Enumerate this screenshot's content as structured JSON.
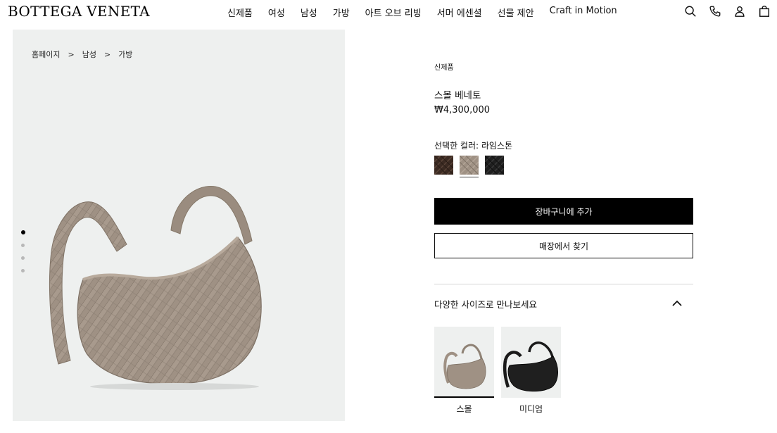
{
  "header": {
    "logo": "BOTTEGA VENETA",
    "nav": [
      "신제품",
      "여성",
      "남성",
      "가방",
      "아트 오브 리빙",
      "서머 에센셜",
      "선물 제안",
      "Craft in Motion"
    ],
    "icons": [
      "search-icon",
      "phone-icon",
      "account-icon",
      "shopping-bag-icon"
    ]
  },
  "breadcrumb": [
    "홈페이지",
    "남성",
    "가방"
  ],
  "gallery": {
    "dots": 4,
    "active_dot": 1
  },
  "product": {
    "badge": "신제품",
    "name": "스몰 베네토",
    "price": "₩4,300,000",
    "color_label": "선택한 컬러: 라임스톤",
    "colors": [
      {
        "name": "dark-brown",
        "hex": "#3b2a22"
      },
      {
        "name": "limestone",
        "hex": "#9f9184",
        "selected": true
      },
      {
        "name": "black",
        "hex": "#1f1f1f"
      }
    ],
    "add_to_cart": "장바구니에 추가",
    "find_in_store": "매장에서 찾기"
  },
  "sizes": {
    "title": "다양한 사이즈로 만나보세요",
    "items": [
      {
        "label": "스몰",
        "selected": true
      },
      {
        "label": "미디엄",
        "selected": false
      }
    ]
  }
}
